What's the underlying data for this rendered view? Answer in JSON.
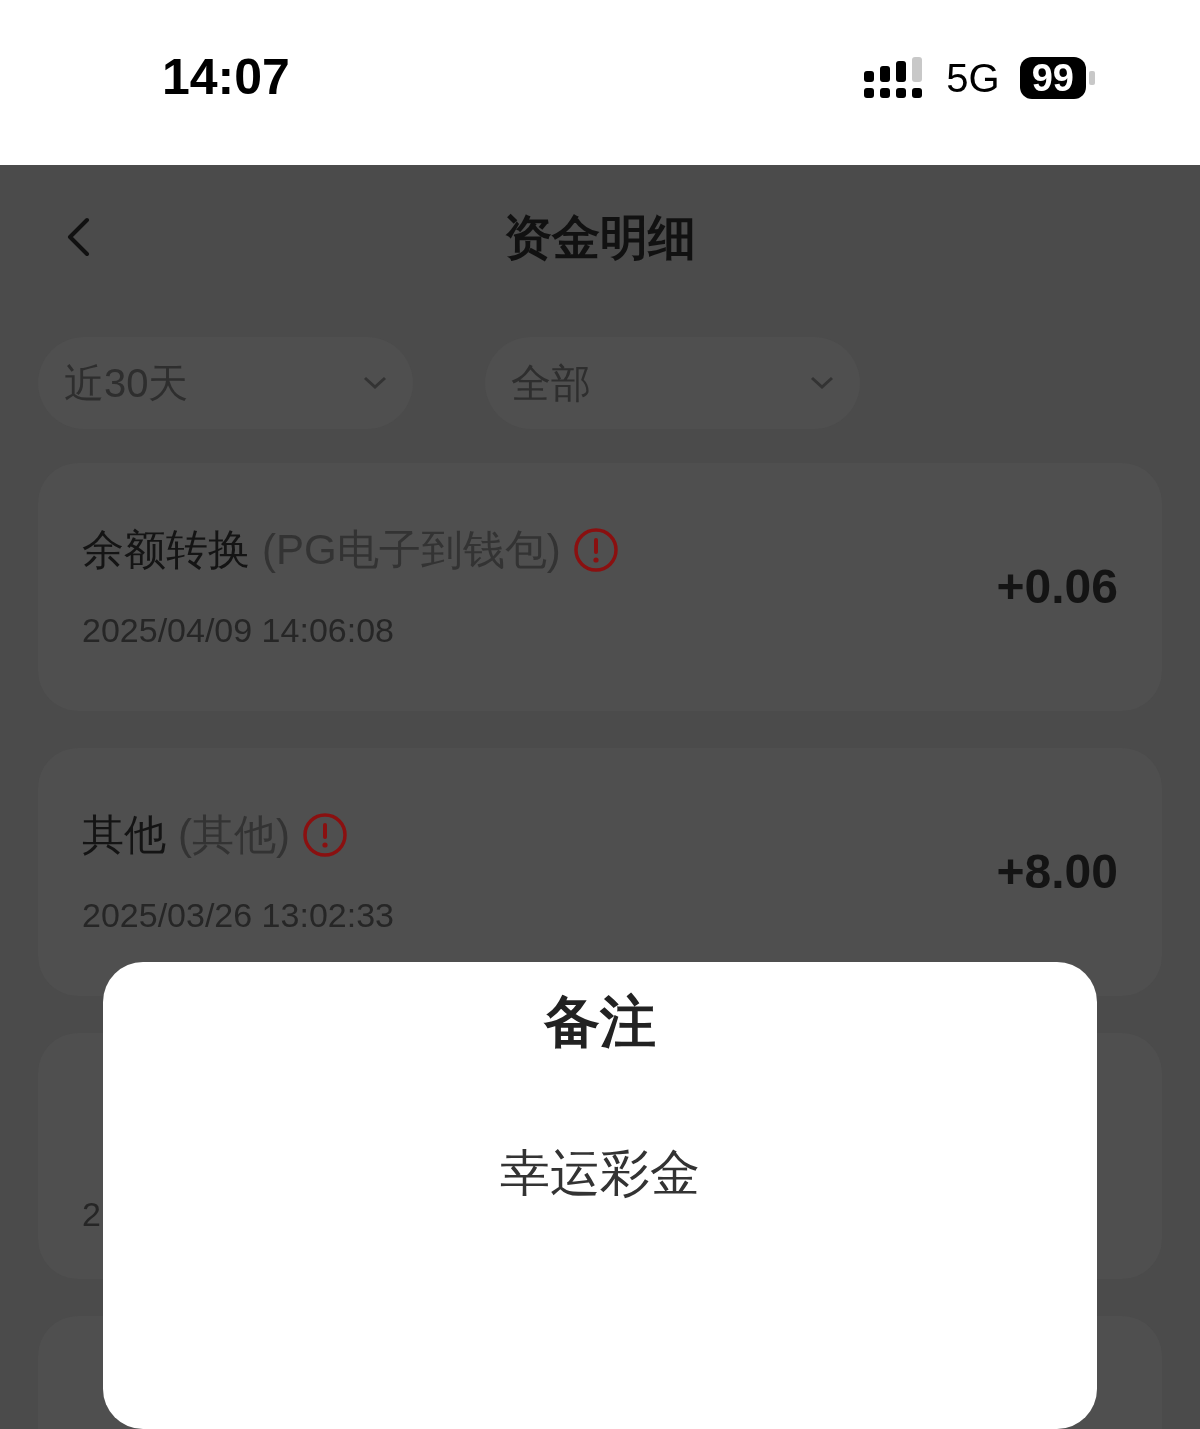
{
  "status_bar": {
    "time": "14:07",
    "network": "5G",
    "battery": "99"
  },
  "header": {
    "title": "资金明细"
  },
  "filters": [
    {
      "label": "近30天"
    },
    {
      "label": "全部"
    }
  ],
  "records": [
    {
      "kind": "full",
      "type": "余额转换",
      "detail": "(PG电子到钱包)",
      "date": "2025/04/09 14:06:08",
      "amount": "+0.06"
    },
    {
      "kind": "full",
      "type": "其他",
      "detail": "(其他)",
      "date": "2025/03/26 13:02:33",
      "amount": "+8.00"
    },
    {
      "kind": "covered",
      "date": "2"
    },
    {
      "kind": "covered"
    }
  ],
  "dialog": {
    "title": "备注",
    "message": "幸运彩金"
  }
}
